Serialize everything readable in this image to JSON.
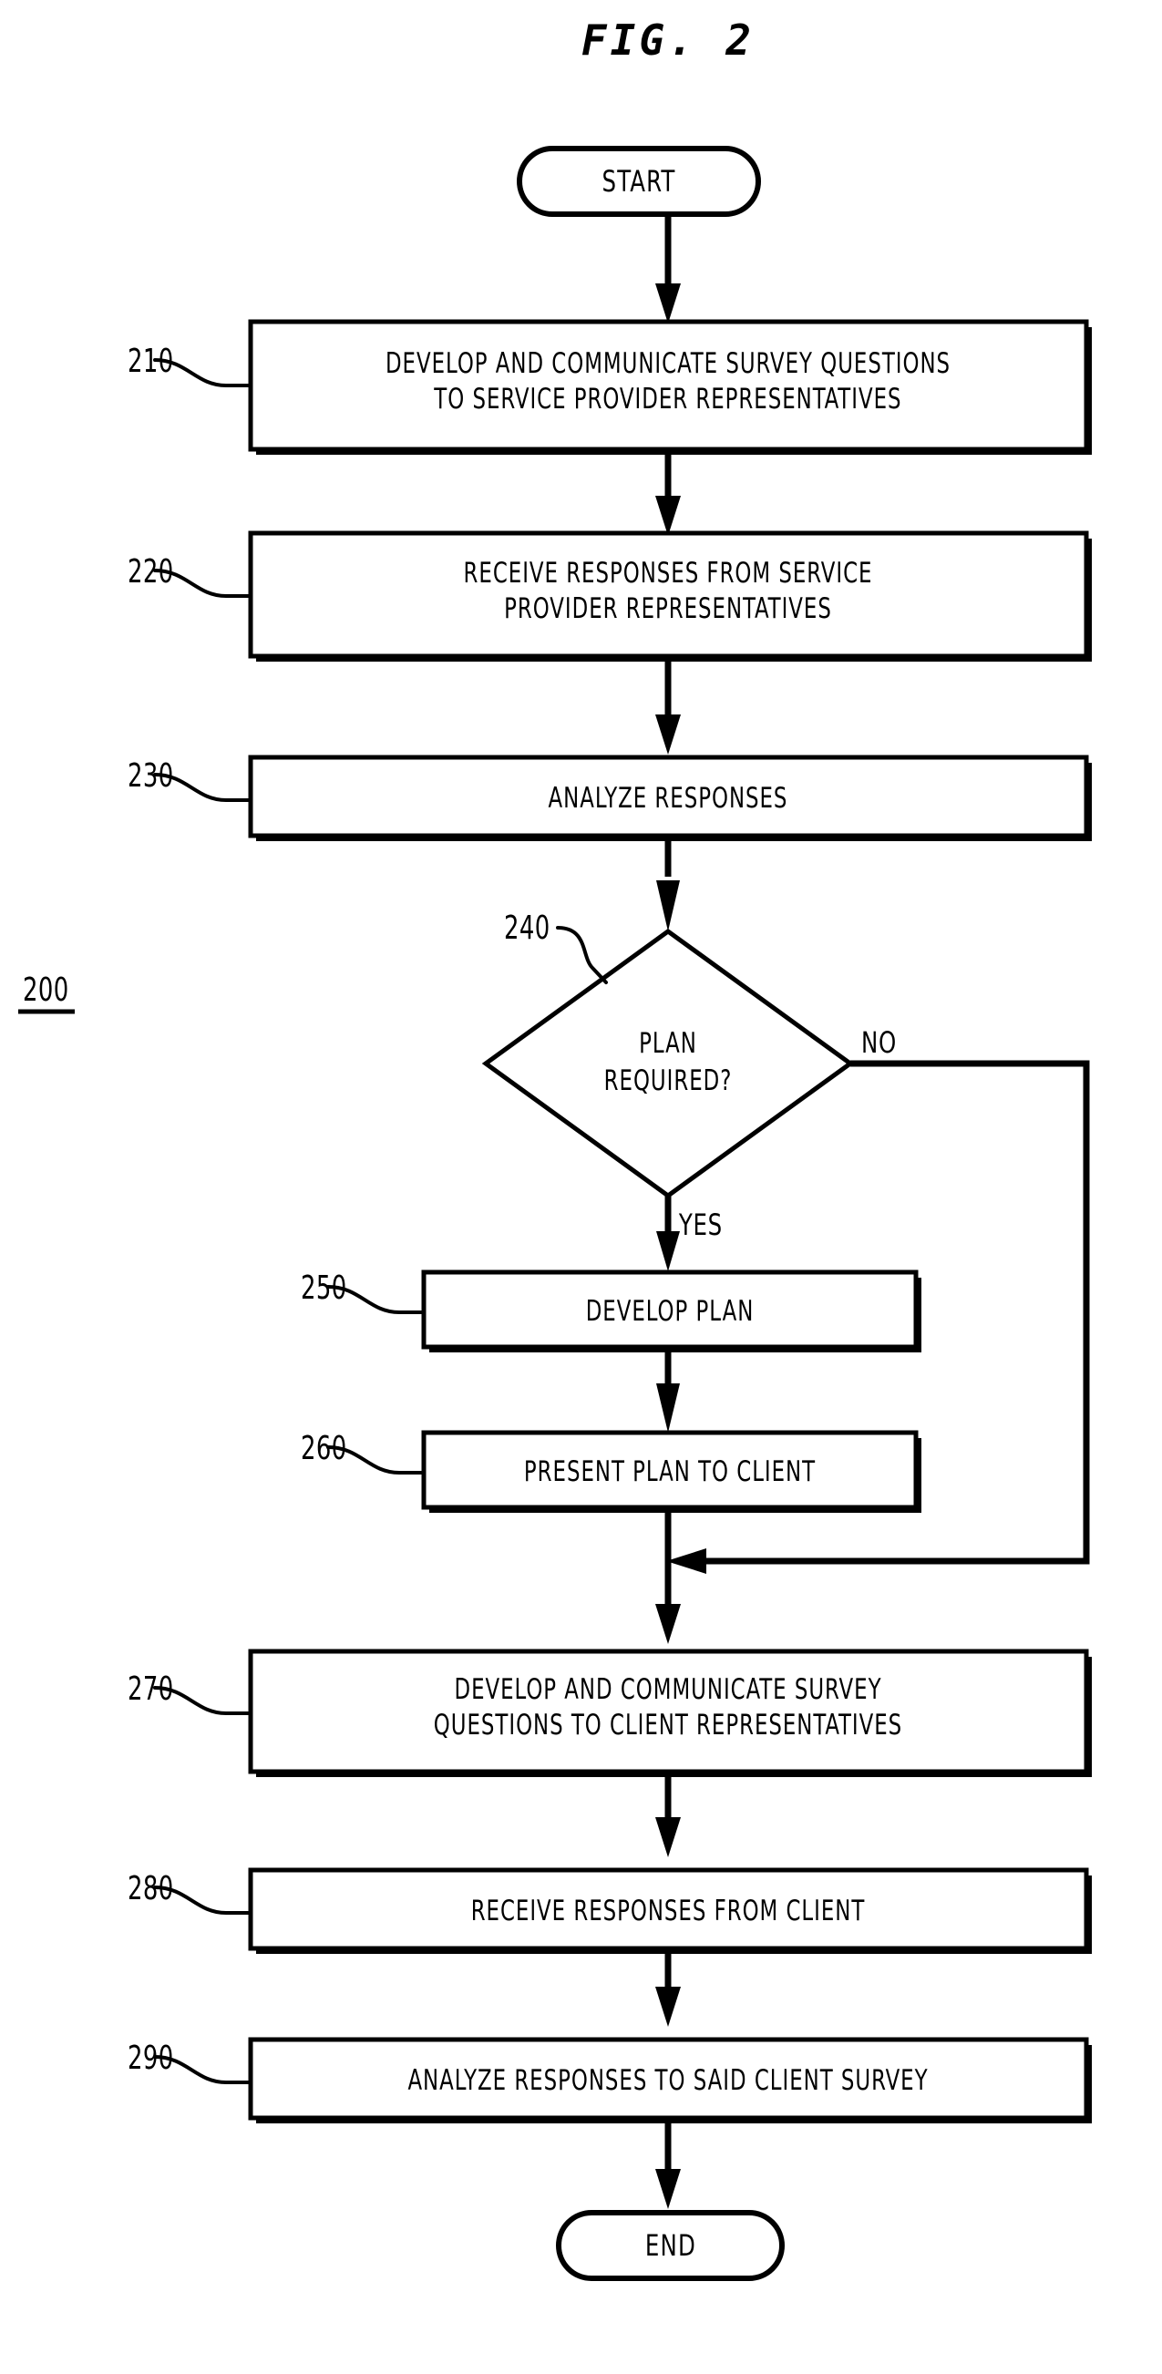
{
  "figure": {
    "title": "FIG. 2",
    "diagram_number": "200",
    "type": "flowchart"
  },
  "nodes": {
    "start": {
      "ref": "",
      "label": "START",
      "shape": "terminator"
    },
    "n210": {
      "ref": "210",
      "label_line1": "DEVELOP AND COMMUNICATE SURVEY QUESTIONS",
      "label_line2": "TO SERVICE PROVIDER REPRESENTATIVES",
      "shape": "process"
    },
    "n220": {
      "ref": "220",
      "label_line1": "RECEIVE RESPONSES FROM SERVICE",
      "label_line2": "PROVIDER REPRESENTATIVES",
      "shape": "process"
    },
    "n230": {
      "ref": "230",
      "label_line1": "ANALYZE RESPONSES",
      "label_line2": "",
      "shape": "process"
    },
    "n240": {
      "ref": "240",
      "label_line1": "PLAN",
      "label_line2": "REQUIRED?",
      "shape": "decision"
    },
    "n250": {
      "ref": "250",
      "label_line1": "DEVELOP PLAN",
      "label_line2": "",
      "shape": "process"
    },
    "n260": {
      "ref": "260",
      "label_line1": "PRESENT PLAN TO CLIENT",
      "label_line2": "",
      "shape": "process"
    },
    "n270": {
      "ref": "270",
      "label_line1": "DEVELOP AND COMMUNICATE SURVEY",
      "label_line2": "QUESTIONS TO CLIENT REPRESENTATIVES",
      "shape": "process"
    },
    "n280": {
      "ref": "280",
      "label_line1": "RECEIVE RESPONSES FROM CLIENT",
      "label_line2": "",
      "shape": "process"
    },
    "n290": {
      "ref": "290",
      "label_line1": "ANALYZE RESPONSES TO SAID CLIENT SURVEY",
      "label_line2": "",
      "shape": "process"
    },
    "end": {
      "ref": "",
      "label": "END",
      "shape": "terminator"
    }
  },
  "branches": {
    "yes_label": "YES",
    "no_label": "NO"
  },
  "colors": {
    "ink": "#000000",
    "paper": "#ffffff"
  }
}
